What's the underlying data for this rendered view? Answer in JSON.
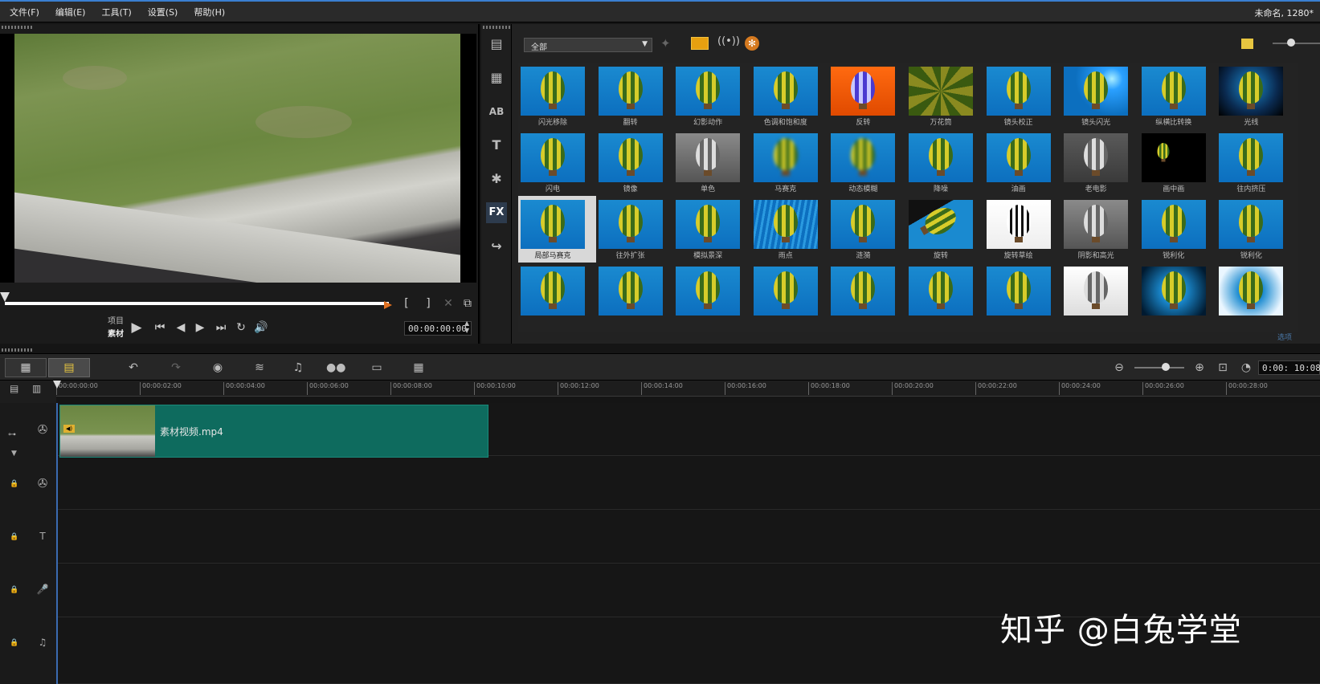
{
  "menu": {
    "items": [
      "文件(F)",
      "编辑(E)",
      "工具(T)",
      "设置(S)",
      "帮助(H)"
    ]
  },
  "project_title": "未命名, 1280*",
  "player": {
    "mode_labels": [
      "项目",
      "素材"
    ],
    "timecode": "00:00:00:00",
    "controls": [
      "play",
      "home",
      "prev-frame",
      "next-frame",
      "end",
      "repeat",
      "volume"
    ],
    "trim": [
      "[",
      "]"
    ]
  },
  "library": {
    "filter_value": "全部",
    "side_buttons": [
      "media-icon",
      "instant-project-icon",
      "transition-icon",
      "title-icon",
      "graphic-icon",
      "filter-icon",
      "path-icon"
    ],
    "fx_label": "FX",
    "filters": [
      {
        "label": "闪光移除",
        "style": "blue"
      },
      {
        "label": "翻转",
        "style": "blue"
      },
      {
        "label": "幻影动作",
        "style": "blue"
      },
      {
        "label": "色调和饱和度",
        "style": "blue"
      },
      {
        "label": "反转",
        "style": "invert"
      },
      {
        "label": "万花筒",
        "style": "kaleido"
      },
      {
        "label": "镜头校正",
        "style": "blue"
      },
      {
        "label": "镜头闪光",
        "style": "flare"
      },
      {
        "label": "纵横比转换",
        "style": "blue"
      },
      {
        "label": "光线",
        "style": "dark"
      },
      {
        "label": "闪电",
        "style": "blue"
      },
      {
        "label": "镜像",
        "style": "blue"
      },
      {
        "label": "单色",
        "style": "gray"
      },
      {
        "label": "马赛克",
        "style": "mosaic"
      },
      {
        "label": "动态模糊",
        "style": "blur"
      },
      {
        "label": "降噪",
        "style": "blue"
      },
      {
        "label": "油画",
        "style": "blue"
      },
      {
        "label": "老电影",
        "style": "oldfilm"
      },
      {
        "label": "画中画",
        "style": "pip"
      },
      {
        "label": "往内挤压",
        "style": "blue"
      },
      {
        "label": "局部马赛克",
        "style": "blue",
        "selected": true
      },
      {
        "label": "往外扩张",
        "style": "blue"
      },
      {
        "label": "模拟景深",
        "style": "blue"
      },
      {
        "label": "雨点",
        "style": "rain"
      },
      {
        "label": "涟漪",
        "style": "blue"
      },
      {
        "label": "旋转",
        "style": "rotate"
      },
      {
        "label": "旋转草绘",
        "style": "sketch"
      },
      {
        "label": "阴影和高光",
        "style": "gray"
      },
      {
        "label": "锐利化",
        "style": "blue"
      },
      {
        "label": "锐利化",
        "style": "blue"
      },
      {
        "label": "",
        "style": "blue"
      },
      {
        "label": "",
        "style": "blue"
      },
      {
        "label": "",
        "style": "blue"
      },
      {
        "label": "",
        "style": "blue"
      },
      {
        "label": "",
        "style": "blue"
      },
      {
        "label": "",
        "style": "blue"
      },
      {
        "label": "",
        "style": "blue"
      },
      {
        "label": "",
        "style": "white"
      },
      {
        "label": "",
        "style": "vignette"
      },
      {
        "label": "",
        "style": "glow"
      }
    ],
    "corner_label": "选项"
  },
  "timeline": {
    "time": "0:00: 10:08",
    "ruler": [
      "00:00:00:00",
      "00:00:02:00",
      "00:00:04:00",
      "00:00:06:00",
      "00:00:08:00",
      "00:00:10:00",
      "00:00:12:00",
      "00:00:14:00",
      "00:00:16:00",
      "00:00:18:00",
      "00:00:20:00",
      "00:00:22:00",
      "00:00:24:00",
      "00:00:26:00",
      "00:00:28:00"
    ],
    "clip_name": "素材视频.mp4",
    "zoom_level": 0.55
  },
  "watermark": "知乎 @白兔学堂"
}
